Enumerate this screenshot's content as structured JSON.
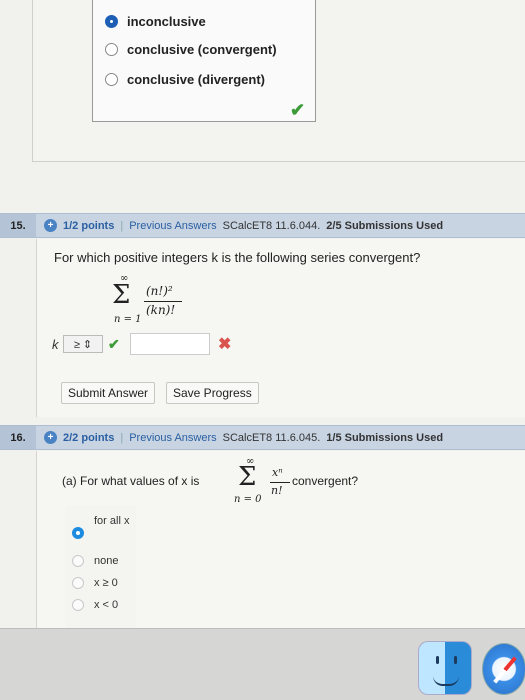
{
  "prev_question": {
    "choices": [
      {
        "label": "inconclusive",
        "selected": true
      },
      {
        "label": "conclusive (convergent)",
        "selected": false
      },
      {
        "label": "conclusive (divergent)",
        "selected": false
      }
    ],
    "result_icon": "check-icon"
  },
  "q15": {
    "number": "15.",
    "plus": "+",
    "points": "1/2 points",
    "separator": "|",
    "previous_answers": "Previous Answers",
    "code": "SCalcET8 11.6.044.",
    "submissions": "2/5 Submissions Used",
    "question": "For which positive integers k is the following series convergent?",
    "series": {
      "sigma": "Σ",
      "upper": "∞",
      "lower": "n = 1",
      "numerator": "(n!)²",
      "denominator": "(kn)!"
    },
    "k_label": "k",
    "k_select_value": "≥ ⇕",
    "k_select_status": "check-icon",
    "answer_value": "",
    "answer_status": "x-icon",
    "submit_label": "Submit Answer",
    "save_label": "Save Progress"
  },
  "q16": {
    "number": "16.",
    "plus": "+",
    "points": "2/2 points",
    "separator": "|",
    "previous_answers": "Previous Answers",
    "code": "SCalcET8 11.6.045.",
    "submissions": "1/5 Submissions Used",
    "part_a_prefix": "(a) For what values of x is",
    "part_a_suffix": "convergent?",
    "series": {
      "sigma": "Σ",
      "upper": "∞",
      "lower": "n = 0",
      "numerator": "xⁿ",
      "denominator": "n!"
    },
    "options": [
      {
        "label": "for all x",
        "selected": true
      },
      {
        "label": "none",
        "selected": false
      },
      {
        "label": "x ≥ 0",
        "selected": false
      },
      {
        "label": "x < 0",
        "selected": false
      }
    ]
  },
  "colors": {
    "accent_blue": "#2a5fa2",
    "correct_green": "#3d9b3a",
    "wrong_red": "#d9534f",
    "header_bar": "#c8d4e2"
  }
}
